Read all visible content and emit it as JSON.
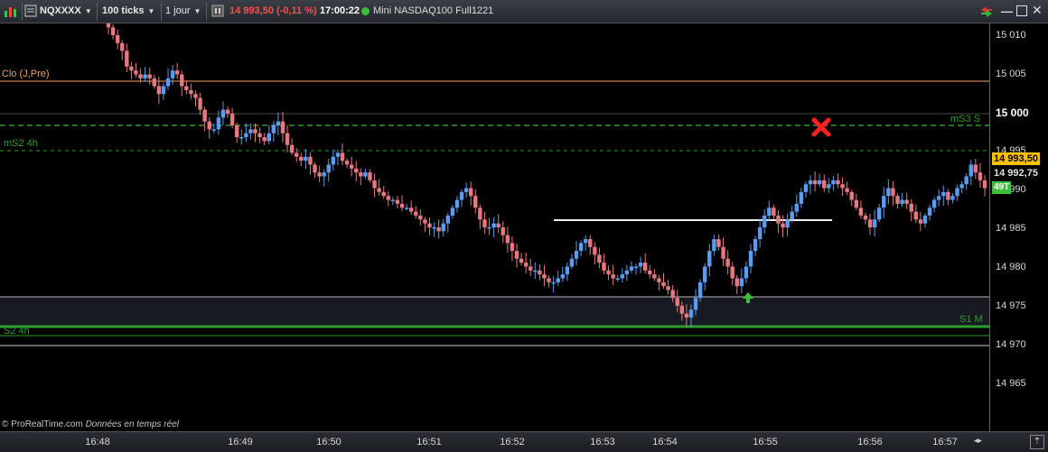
{
  "toolbar": {
    "symbol": "NQXXXX",
    "ticks": "100 ticks",
    "period": "1 jour",
    "price_change": "14 993,50 (-0,11 %)",
    "time": "17:00:22",
    "instrument": "Mini NASDAQ100 Full1221",
    "icons": [
      "chart-icon",
      "list-icon",
      "link-icon",
      "grid-icon",
      "sync-icon",
      "minimize-icon",
      "maximize-icon",
      "close-icon",
      "info-icon"
    ]
  },
  "price_axis": {
    "labels": [
      "15 010",
      "15 005",
      "15 000",
      "14 995",
      "14 990",
      "14 985",
      "14 980",
      "14 975",
      "14 970",
      "14 965"
    ],
    "last_price": "14 993,50",
    "secondary_price": "14 992,75",
    "tick_count": "49T"
  },
  "time_axis": {
    "labels": [
      "16:48",
      "16:49",
      "16:50",
      "16:51",
      "16:52",
      "16:53",
      "16:54",
      "16:55",
      "16:56",
      "16:57"
    ]
  },
  "levels": {
    "clo": "Clo (J,Pre)",
    "ms3": "mS3 S",
    "ms2": "mS2 4h",
    "s2": "S2 4h",
    "s1": "S1 M"
  },
  "footer": {
    "copyright": "© ProRealTime.com",
    "realtime": "Données en temps réel"
  },
  "colors": {
    "up": "#5b9bf0",
    "down": "#e8787f",
    "clo_line": "#f0a060",
    "green_level": "#2e9e2e",
    "last_price_bg": "#ffc000"
  },
  "chart_data": {
    "type": "candlestick",
    "ylim": [
      14961,
      15013
    ],
    "closes": [
      15012.5,
      15011.5,
      15010.5,
      15009.5,
      15007.5,
      15007,
      15006.5,
      15006,
      15006.5,
      15006,
      15005,
      15004,
      15005,
      15006,
      15007,
      15006.5,
      15005,
      15004.5,
      15004,
      15003.5,
      15002,
      15000.5,
      14999.5,
      14999.5,
      15001,
      15002,
      15001.5,
      15000,
      14998.5,
      14998.5,
      14999,
      14999.5,
      14999,
      14998.5,
      14998,
      14999,
      15000,
      15000.5,
      14999,
      14997.5,
      14996.5,
      14996,
      14995.5,
      14996,
      14995,
      14994,
      14993.5,
      14994,
      14995,
      14996,
      14996.5,
      14995.5,
      14995,
      14994.5,
      14994,
      14993.5,
      14994,
      14993,
      14992,
      14991.5,
      14991,
      14990.5,
      14990.5,
      14990,
      14989.5,
      14989.5,
      14989,
      14988.5,
      14988,
      14987.5,
      14987,
      14987,
      14986.5,
      14987.5,
      14988.5,
      14989.5,
      14990.5,
      14991.5,
      14992,
      14991,
      14989.5,
      14988,
      14987,
      14987,
      14987.5,
      14987,
      14986,
      14985,
      14984,
      14983,
      14982.5,
      14982,
      14981.5,
      14981.5,
      14981,
      14980.5,
      14980,
      14980,
      14980.5,
      14981,
      14982,
      14983,
      14984,
      14985,
      14985.5,
      14984.5,
      14983.5,
      14982.5,
      14981.5,
      14981,
      14980.5,
      14980.5,
      14981,
      14981.5,
      14982,
      14982,
      14982.5,
      14981.5,
      14981,
      14980.5,
      14980,
      14979.5,
      14979,
      14978,
      14977,
      14976,
      14975.5,
      14976.5,
      14978,
      14980,
      14982,
      14984,
      14985.5,
      14984.5,
      14983,
      14982,
      14980.5,
      14979.5,
      14980.5,
      14982,
      14984,
      14985.5,
      14987,
      14988.5,
      14989.5,
      14988.5,
      14987.5,
      14987,
      14988,
      14989,
      14990,
      14991.5,
      14992.5,
      14993,
      14992.5,
      14993,
      14992,
      14992.5,
      14993,
      14992.5,
      14992,
      14991.5,
      14990.5,
      14989.5,
      14988.5,
      14988,
      14987,
      14988,
      14989.5,
      14991,
      14992,
      14991,
      14990,
      14990.5,
      14990,
      14989,
      14988,
      14987.5,
      14988.5,
      14989.5,
      14990.5,
      14991,
      14991.5,
      14990.5,
      14991,
      14992,
      14992.5,
      14993.5,
      14995,
      14994,
      14993,
      14992
    ]
  }
}
